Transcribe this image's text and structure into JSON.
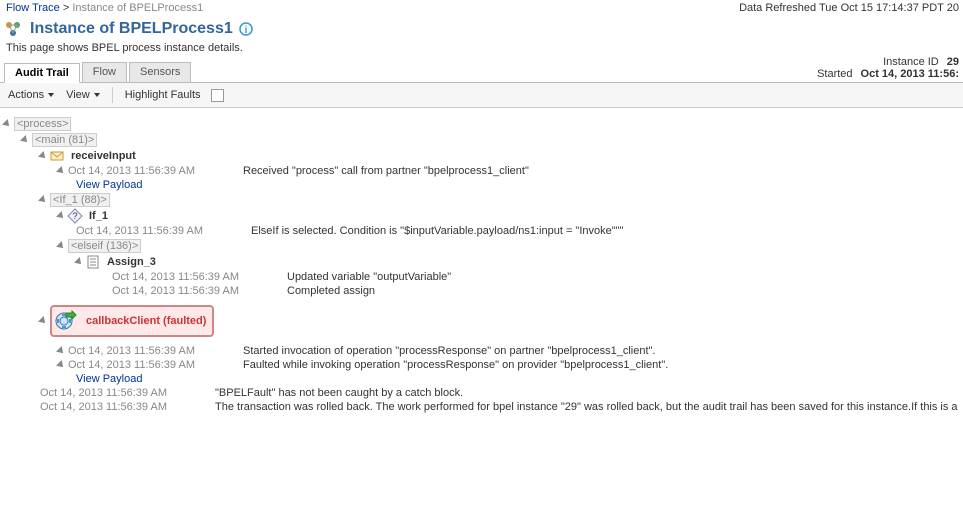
{
  "breadcrumb": {
    "root": "Flow Trace",
    "current": "Instance of BPELProcess1"
  },
  "dataRefreshed": "Data Refreshed Tue Oct 15 17:14:37 PDT 20",
  "header": {
    "title": "Instance of BPELProcess1",
    "subtitle": "This page shows BPEL process instance details."
  },
  "meta": {
    "instanceIdLabel": "Instance ID",
    "instanceId": "29",
    "startedLabel": "Started",
    "started": "Oct 14, 2013 11:56:"
  },
  "tabs": {
    "t0": "Audit Trail",
    "t1": "Flow",
    "t2": "Sensors"
  },
  "toolbar": {
    "actions": "Actions",
    "view": "View",
    "highlight": "Highlight Faults"
  },
  "tree": {
    "process": "<process>",
    "main": "<main (81)>",
    "receiveInput": "receiveInput",
    "r1_ts": "Oct 14, 2013 11:56:39 AM",
    "r1_msg": "Received \"process\" call from partner \"bpelprocess1_client\"",
    "viewPayload": "View Payload",
    "if1box": "<If_1 (88)>",
    "if1": "If_1",
    "if1_ts": "Oct 14, 2013 11:56:39 AM",
    "if1_msg": "ElseIf is selected. Condition is \"$inputVariable.payload/ns1:input = \"Invoke\"\"\"",
    "elseif": "<elseif (136)>",
    "assign3": "Assign_3",
    "a3_ts1": "Oct 14, 2013 11:56:39 AM",
    "a3_msg1": "Updated variable \"outputVariable\"",
    "a3_ts2": "Oct 14, 2013 11:56:39 AM",
    "a3_msg2": "Completed assign",
    "callback": "callbackClient (faulted)",
    "cb_ts1": "Oct 14, 2013 11:56:39 AM",
    "cb_msg1": "Started invocation of operation \"processResponse\" on partner \"bpelprocess1_client\".",
    "cb_ts2": "Oct 14, 2013 11:56:39 AM",
    "cb_msg2": "Faulted while invoking operation \"processResponse\" on provider \"bpelprocess1_client\".",
    "f_ts1": "Oct 14, 2013 11:56:39 AM",
    "f_msg1": "\"BPELFault\" has not been caught by a catch block.",
    "f_ts2": "Oct 14, 2013 11:56:39 AM",
    "f_msg2": "The transaction was rolled back. The work performed for bpel instance \"29\" was rolled back, but the audit trail has been saved for this instance.If this is a"
  }
}
